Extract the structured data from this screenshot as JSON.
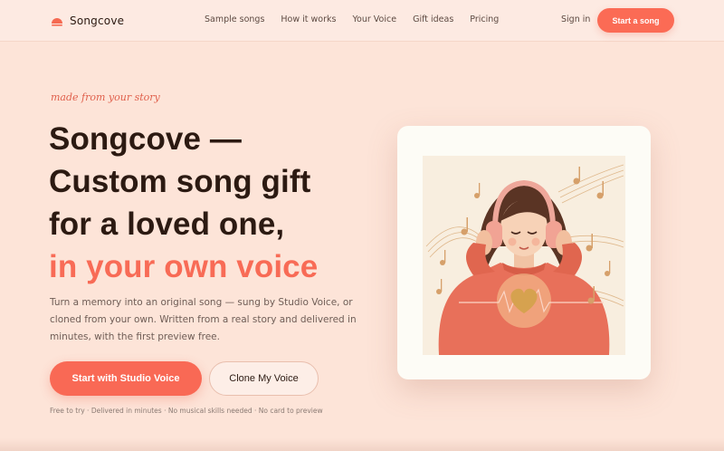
{
  "brand": {
    "name": "Songcove",
    "logo_icon": "half-sun-icon",
    "accent_color": "#f86b56"
  },
  "nav": {
    "links": [
      "Sample songs",
      "How it works",
      "Your Voice",
      "Gift ideas",
      "Pricing"
    ],
    "sign_in": "Sign in",
    "cta": "Start a song"
  },
  "hero": {
    "tagline": "made from your story",
    "headline_lines": [
      "Songcove —",
      "Custom song gift",
      "for a loved one,"
    ],
    "headline_accent": "in your own voice",
    "description": "Turn a memory into an original song — sung by Studio Voice, or cloned from your own. Written from a real story and delivered in minutes, with the first preview free.",
    "primary_button": "Start with Studio Voice",
    "secondary_button": "Clone My Voice",
    "features": "Free to try · Delivered in minutes · No musical skills needed · No card to preview"
  },
  "illustration": {
    "subject": "girl-with-headphones-illustration",
    "heart_icon": "heart-icon",
    "notes_icon": "music-note-icon"
  }
}
